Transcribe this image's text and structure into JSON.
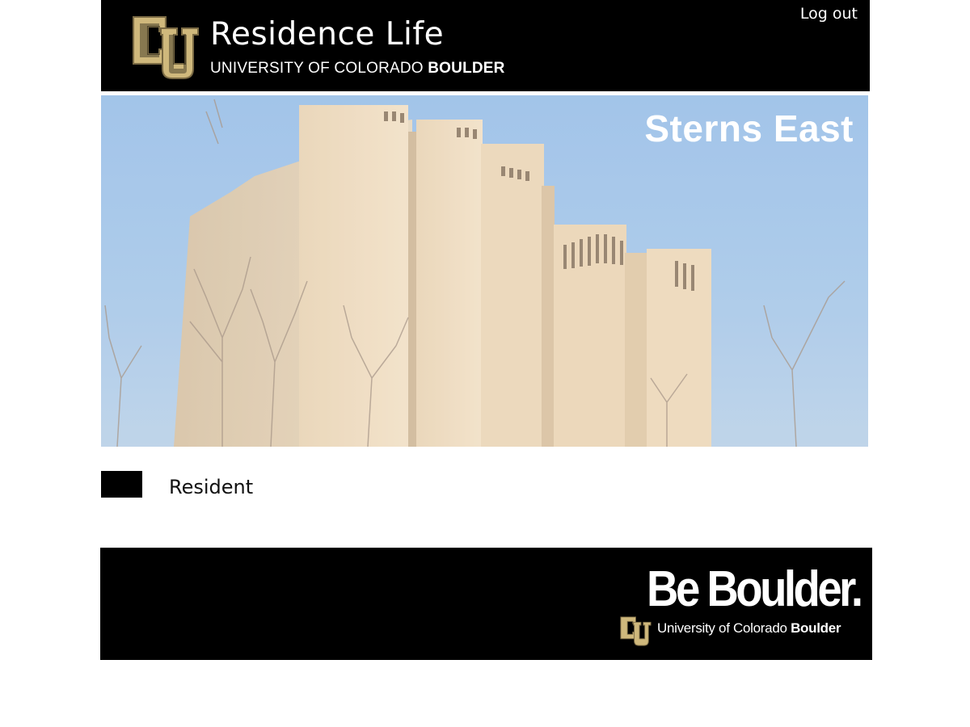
{
  "header": {
    "title": "Residence Life",
    "subtitle_plain": "UNIVERSITY OF COLORADO ",
    "subtitle_bold": "BOULDER",
    "logout_label": "Log out",
    "logo_icon": "cu-logo-icon"
  },
  "hero": {
    "title": "Sterns East"
  },
  "role": {
    "label": "Resident"
  },
  "footer": {
    "tagline": "Be Boulder.",
    "university_plain": "University of Colorado ",
    "university_bold": "Boulder",
    "logo_icon": "cu-logo-icon"
  },
  "colors": {
    "header_bg": "#000000",
    "gold": "#cfb87c",
    "sky": "#9fc3e7",
    "brick": "#e3c8a4",
    "text_light": "#ffffff"
  }
}
